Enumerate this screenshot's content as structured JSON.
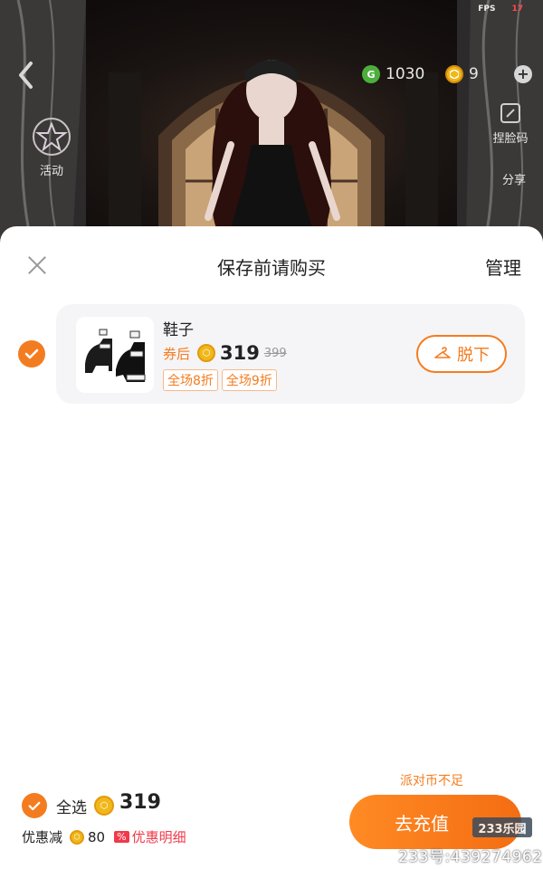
{
  "status": {
    "fps_label": "FPS",
    "fps_value": "17"
  },
  "hud": {
    "gem_symbol": "G",
    "gem_value": "1030",
    "coin_value": "9",
    "plus": "+",
    "activity_label": "活动",
    "facecode_label": "捏脸码",
    "share_label": "分享"
  },
  "sheet": {
    "title": "保存前请购买",
    "manage": "管理",
    "item": {
      "name": "鞋子",
      "after_coupon": "券后",
      "price": "319",
      "original_price": "399",
      "tags": [
        "全场8折",
        "全场9折"
      ],
      "take_off": "脱下",
      "thumbnail_icon": "platform-heels-icon"
    },
    "insufficient": "派对币不足",
    "select_all": "全选",
    "total": "319",
    "discount_label": "优惠减",
    "discount_amount": "80",
    "discount_pct": "%",
    "discount_detail": "优惠明细",
    "recharge": "去充值"
  },
  "watermark": {
    "badge": "233乐园",
    "text": "233号:439274962"
  },
  "colors": {
    "accent": "#f47c20",
    "coin": "#f0b81b",
    "gem": "#4caf3c",
    "discount_red": "#f03a4b"
  }
}
